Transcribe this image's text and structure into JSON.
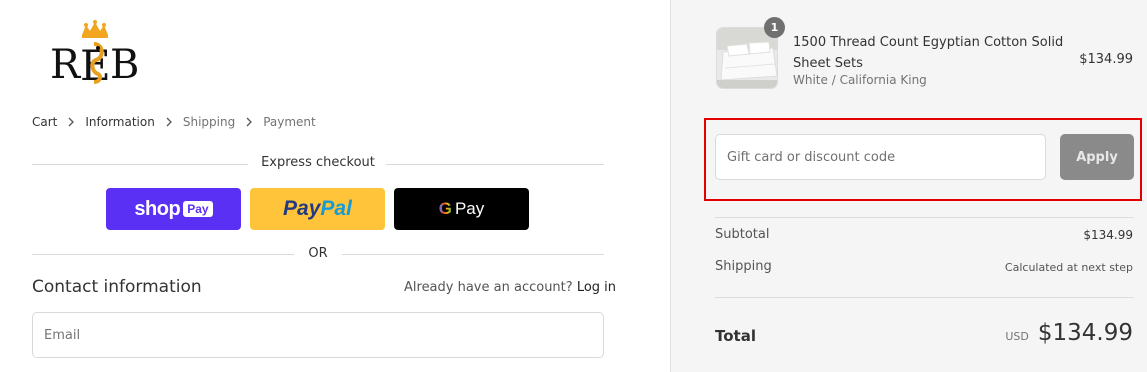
{
  "brand": {
    "logo_text": "REB"
  },
  "breadcrumb": [
    {
      "label": "Cart",
      "state": "link"
    },
    {
      "label": "Information",
      "state": "active"
    },
    {
      "label": "Shipping",
      "state": "inactive"
    },
    {
      "label": "Payment",
      "state": "inactive"
    }
  ],
  "express": {
    "title": "Express checkout",
    "shop_pay": {
      "word": "shop",
      "badge": "Pay",
      "color": "#5a31f4"
    },
    "paypal": {
      "part1": "Pay",
      "part2": "Pal",
      "color": "#ffc439"
    },
    "gpay": {
      "g": "G",
      "pay": "Pay",
      "color": "#000000"
    },
    "or_label": "OR"
  },
  "contact": {
    "title": "Contact information",
    "account_prompt": "Already have an account?",
    "login_label": "Log in",
    "email_placeholder": "Email"
  },
  "order": {
    "item": {
      "quantity": "1",
      "name": "1500 Thread Count Egyptian Cotton Solid Sheet Sets",
      "variant": "White / California King",
      "price": "$134.99",
      "image_icon": "bedsheet-product-image"
    },
    "discount": {
      "placeholder": "Gift card or discount code",
      "apply_label": "Apply",
      "highlight_color": "#e50000"
    },
    "subtotal_label": "Subtotal",
    "subtotal_value": "$134.99",
    "shipping_label": "Shipping",
    "shipping_value": "Calculated at next step",
    "total_label": "Total",
    "total_currency": "USD",
    "total_value": "$134.99"
  }
}
